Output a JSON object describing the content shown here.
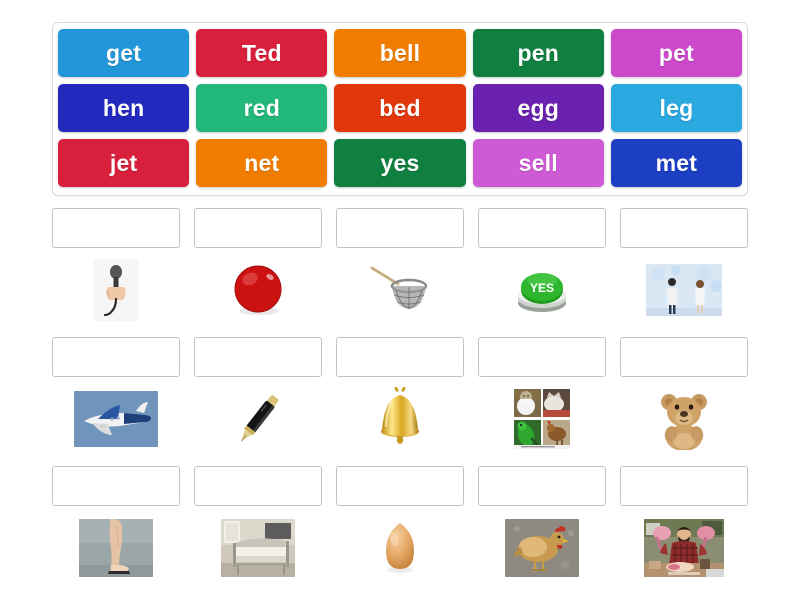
{
  "activity": {
    "type": "word-to-picture matching",
    "word_bank": {
      "rows": [
        [
          {
            "label": "get",
            "color": "#2196d8"
          },
          {
            "label": "Ted",
            "color": "#d8203c"
          },
          {
            "label": "bell",
            "color": "#f07d00"
          },
          {
            "label": "pen",
            "color": "#0f8040"
          },
          {
            "label": "pet",
            "color": "#cc49cc"
          }
        ],
        [
          {
            "label": "hen",
            "color": "#2329bd"
          },
          {
            "label": "red",
            "color": "#21b87a"
          },
          {
            "label": "bed",
            "color": "#e0380c"
          },
          {
            "label": "egg",
            "color": "#6a21b0"
          },
          {
            "label": "leg",
            "color": "#29a9e0"
          }
        ],
        [
          {
            "label": "jet",
            "color": "#d8203c"
          },
          {
            "label": "net",
            "color": "#f07d00"
          },
          {
            "label": "yes",
            "color": "#0f8040"
          },
          {
            "label": "sell",
            "color": "#cf5ad6"
          },
          {
            "label": "met",
            "color": "#1d3fc4"
          }
        ]
      ]
    },
    "answer_rows": [
      {
        "cells": [
          {
            "drop_value": "",
            "picture": "hand-holding-microphone-image"
          },
          {
            "drop_value": "",
            "picture": "red-ball-image"
          },
          {
            "drop_value": "",
            "picture": "fishing-net-image"
          },
          {
            "drop_value": "",
            "picture": "green-yes-button-image"
          },
          {
            "drop_value": "",
            "picture": "two-people-meeting-image"
          }
        ]
      },
      {
        "cells": [
          {
            "drop_value": "",
            "picture": "jet-airplane-image"
          },
          {
            "drop_value": "",
            "picture": "fountain-pen-image"
          },
          {
            "drop_value": "",
            "picture": "gold-bell-image"
          },
          {
            "drop_value": "",
            "picture": "pets-collage-image"
          },
          {
            "drop_value": "",
            "picture": "teddy-bear-image"
          }
        ]
      },
      {
        "cells": [
          {
            "drop_value": "",
            "picture": "human-leg-image"
          },
          {
            "drop_value": "",
            "picture": "bed-image"
          },
          {
            "drop_value": "",
            "picture": "egg-image"
          },
          {
            "drop_value": "",
            "picture": "hen-chicken-image"
          },
          {
            "drop_value": "",
            "picture": "butcher-selling-meat-image"
          }
        ]
      }
    ]
  },
  "colors": {
    "page_background": "#ffffff",
    "panel_border": "#dcdcdc",
    "drop_box_border": "#c3c3c3",
    "tile_text": "#ffffff"
  }
}
